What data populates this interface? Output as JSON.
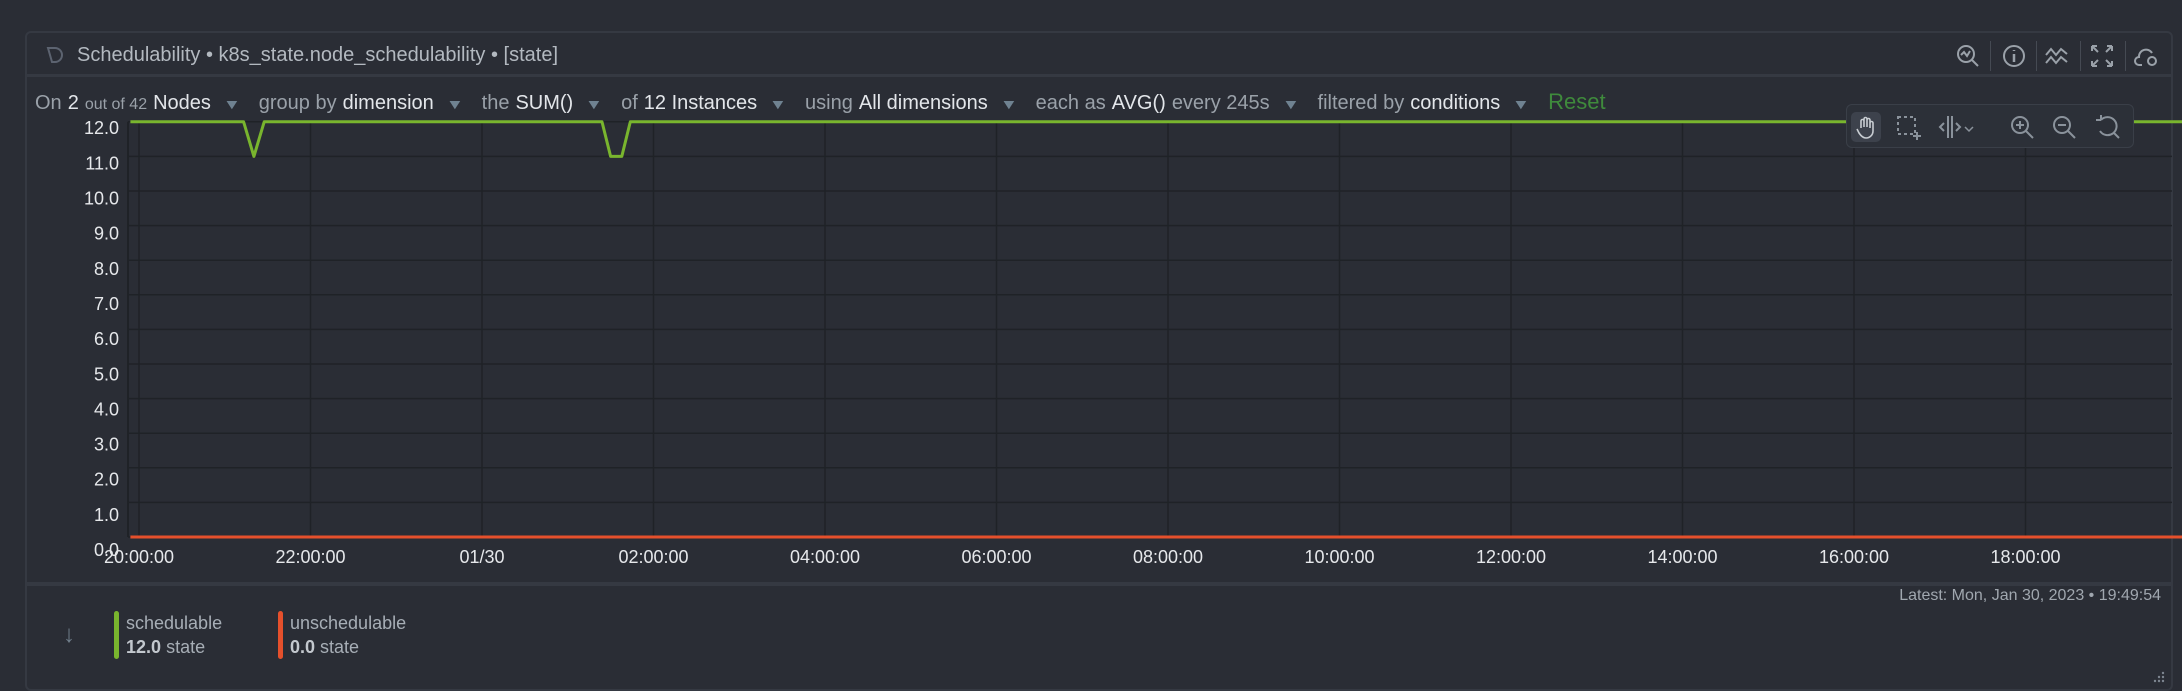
{
  "title": {
    "name": "Schedulability",
    "sep1": " • ",
    "context": "k8s_state.node_schedulability",
    "sep2": " • ",
    "units": "[state]"
  },
  "toolbar": {
    "on": "On",
    "nodes_selected": "2",
    "out_of": "out of 42",
    "nodes": "Nodes",
    "group_by": "group by",
    "group_value": "dimension",
    "the": "the",
    "agg": "SUM()",
    "of": "of",
    "instances": "12 Instances",
    "using": "using",
    "dimensions": "All dimensions",
    "each_as": "each as",
    "time_agg": "AVG()",
    "every": "every 245s",
    "filtered_by": "filtered by",
    "filter_value": "conditions",
    "reset": "Reset"
  },
  "header_icons": [
    "search-chart-icon",
    "info-icon",
    "correlations-icon",
    "fullscreen-icon",
    "alert-cloud-icon"
  ],
  "zoom_tools": [
    "pan-hand-icon",
    "select-area-icon",
    "highlight-icon",
    "zoom-in-icon",
    "zoom-out-icon",
    "reset-zoom-icon"
  ],
  "latest": "Latest: Mon, Jan 30, 2023 • 19:49:54",
  "legend": [
    {
      "name": "schedulable",
      "value": "12.0",
      "unit": "state",
      "color": "#79b52e"
    },
    {
      "name": "unschedulable",
      "value": "0.0",
      "unit": "state",
      "color": "#e5502c"
    }
  ],
  "chart_data": {
    "type": "line",
    "x_unit": "hours since 20:00:00 Jan 29",
    "xlim": [
      -0.1,
      23.83
    ],
    "ylim": [
      0,
      12
    ],
    "yticks": [
      "0.0",
      "1.0",
      "2.0",
      "3.0",
      "4.0",
      "5.0",
      "6.0",
      "7.0",
      "8.0",
      "9.0",
      "10.0",
      "11.0",
      "12.0"
    ],
    "xticks": [
      {
        "h": 0,
        "label": "20:00:00"
      },
      {
        "h": 2,
        "label": "22:00:00"
      },
      {
        "h": 4,
        "label": "01/30"
      },
      {
        "h": 6,
        "label": "02:00:00"
      },
      {
        "h": 8,
        "label": "04:00:00"
      },
      {
        "h": 10,
        "label": "06:00:00"
      },
      {
        "h": 12,
        "label": "08:00:00"
      },
      {
        "h": 14,
        "label": "10:00:00"
      },
      {
        "h": 16,
        "label": "12:00:00"
      },
      {
        "h": 18,
        "label": "14:00:00"
      },
      {
        "h": 20,
        "label": "16:00:00"
      },
      {
        "h": 22,
        "label": "18:00:00"
      }
    ],
    "grid": true,
    "series": [
      {
        "name": "schedulable",
        "color": "#79b52e",
        "points": [
          [
            -0.1,
            12
          ],
          [
            1.22,
            12
          ],
          [
            1.34,
            11
          ],
          [
            1.46,
            12
          ],
          [
            5.4,
            12
          ],
          [
            5.5,
            11
          ],
          [
            5.63,
            11
          ],
          [
            5.73,
            12
          ],
          [
            23.83,
            12
          ]
        ]
      },
      {
        "name": "unschedulable",
        "color": "#e5502c",
        "points": [
          [
            -0.1,
            0
          ],
          [
            23.83,
            0
          ]
        ]
      }
    ]
  }
}
